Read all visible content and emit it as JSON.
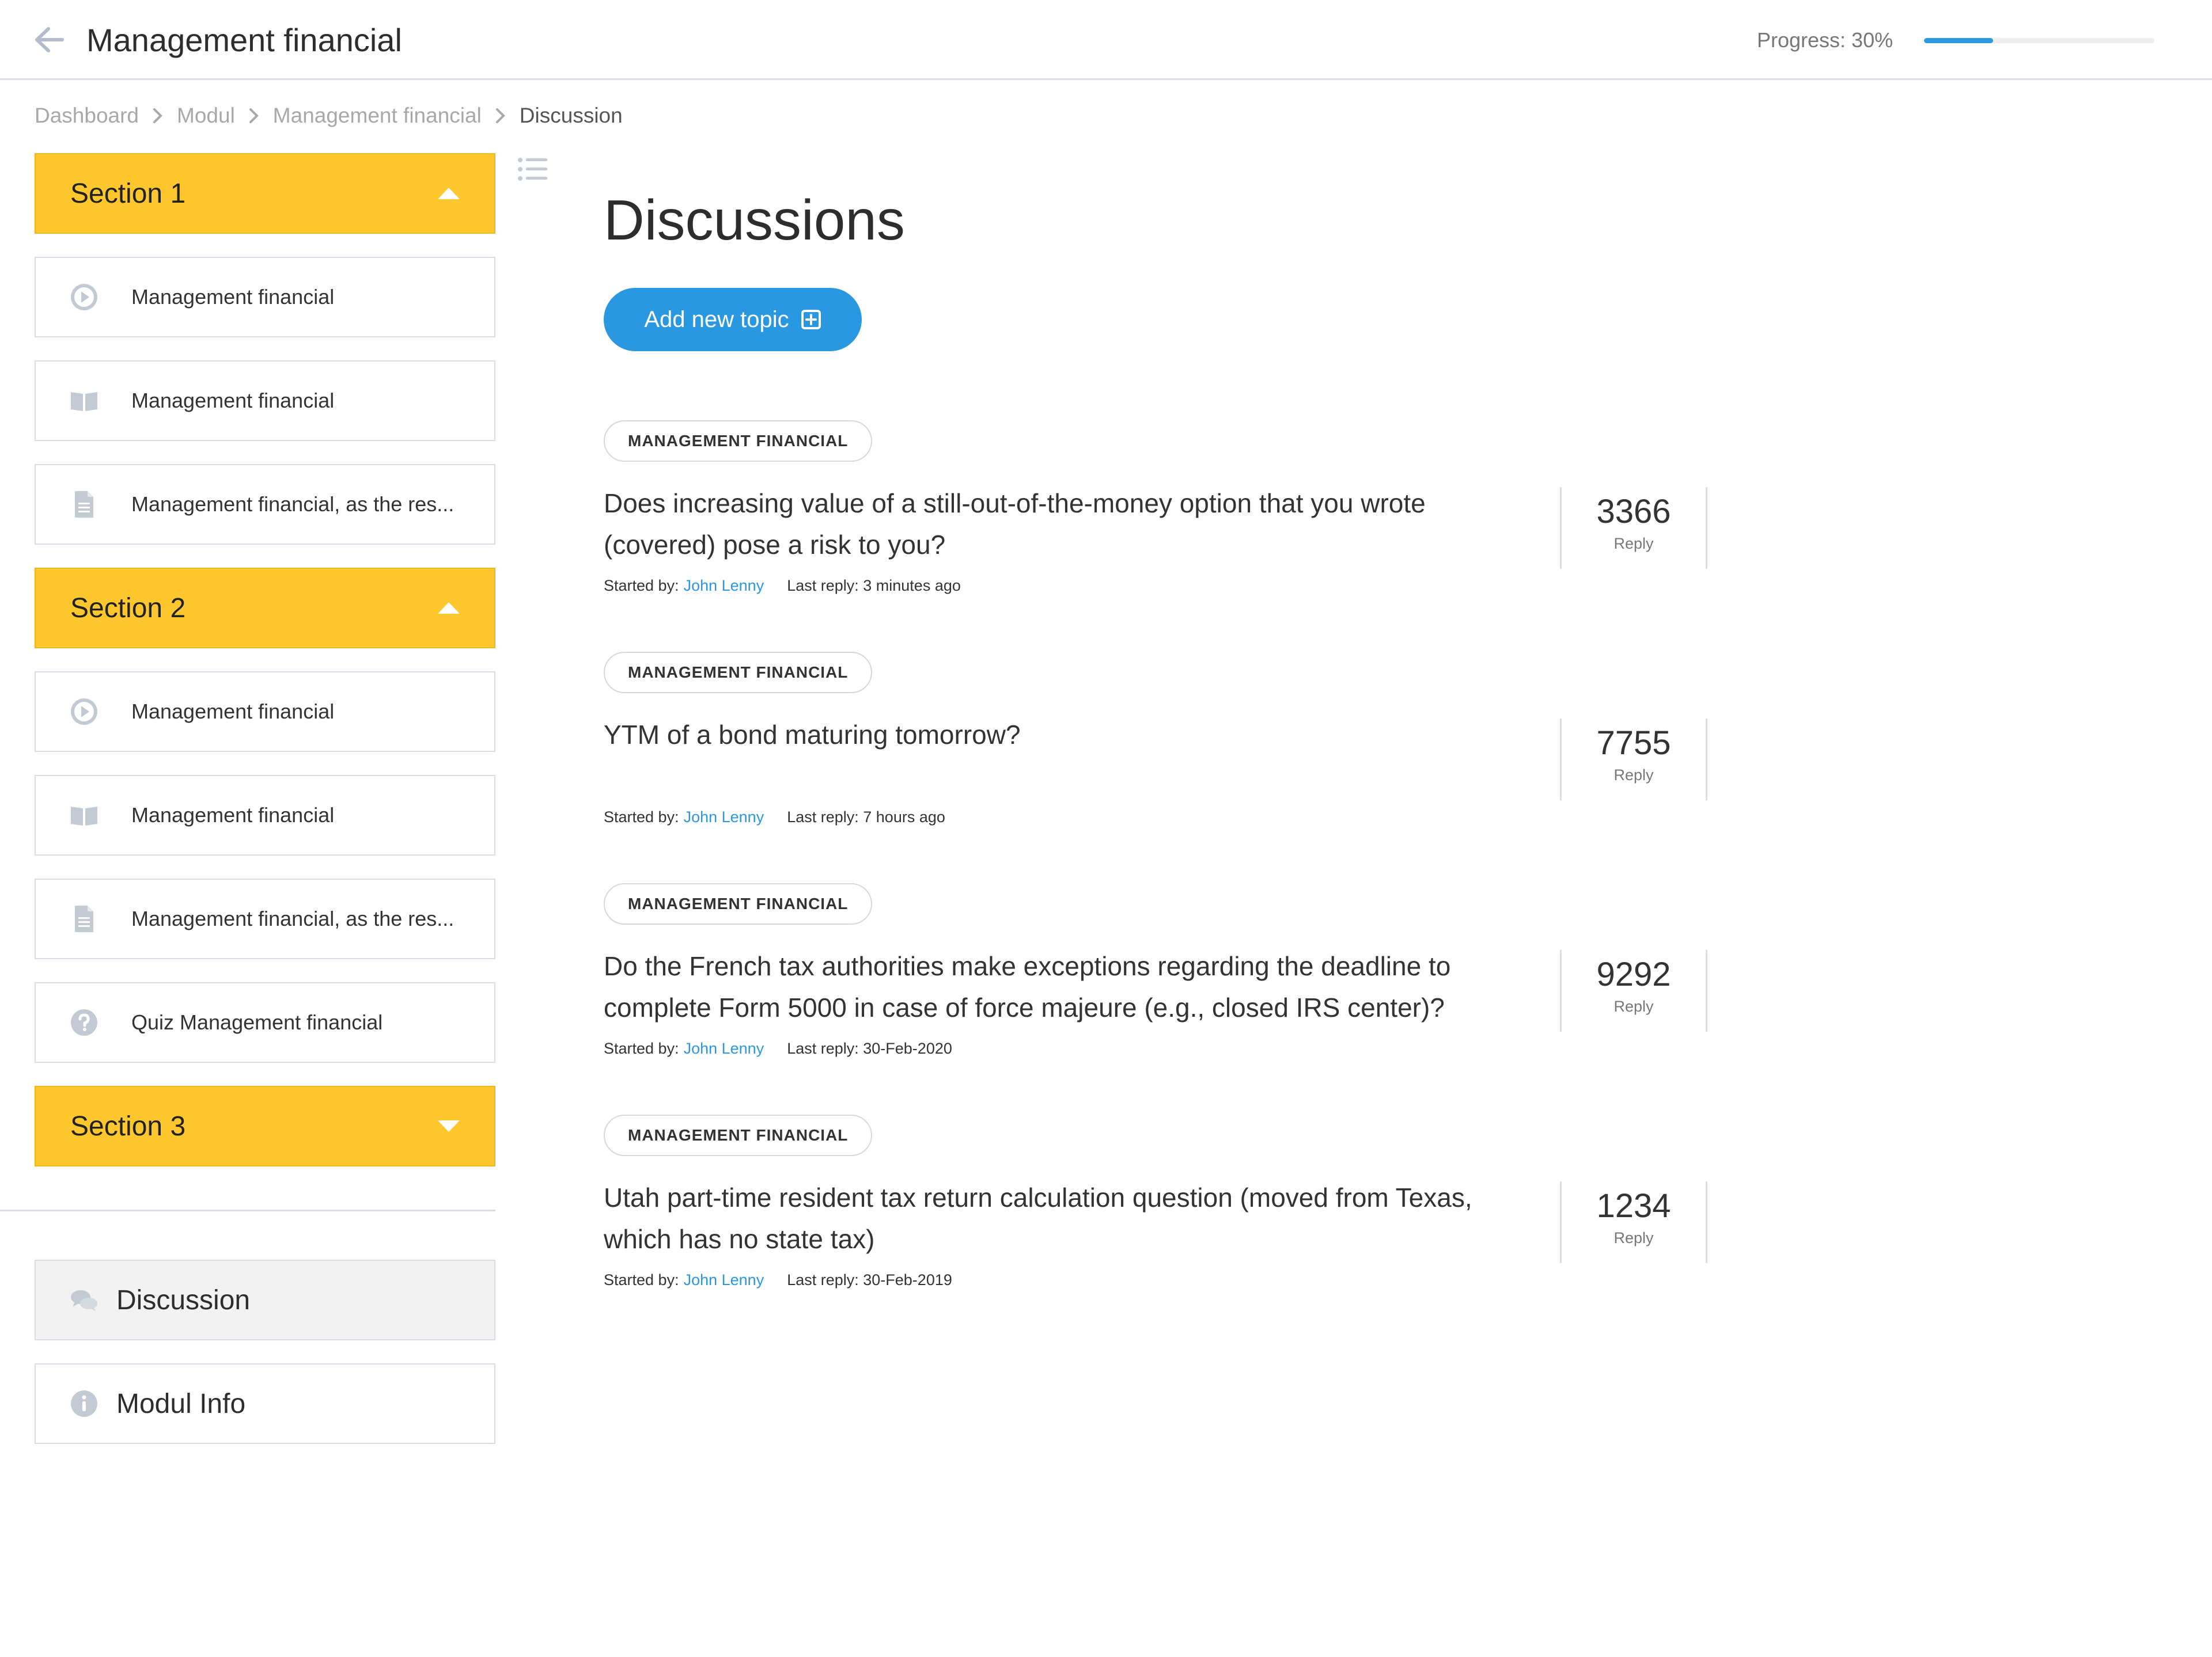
{
  "header": {
    "title": "Management financial",
    "progress_label": "Progress: 30%",
    "progress_value": 0.3
  },
  "breadcrumb": [
    "Dashboard",
    "Modul",
    "Management financial",
    "Discussion"
  ],
  "sidebar": {
    "sections": [
      {
        "title": "Section 1",
        "expanded": true,
        "items": [
          {
            "icon": "play-circle-icon",
            "label": "Management financial"
          },
          {
            "icon": "book-icon",
            "label": "Management financial"
          },
          {
            "icon": "document-icon",
            "label": "Management financial, as the res..."
          }
        ]
      },
      {
        "title": "Section 2",
        "expanded": true,
        "items": [
          {
            "icon": "play-circle-icon",
            "label": "Management financial"
          },
          {
            "icon": "book-icon",
            "label": "Management financial"
          },
          {
            "icon": "document-icon",
            "label": "Management financial, as the res..."
          },
          {
            "icon": "question-circle-icon",
            "label": "Quiz Management financial"
          }
        ]
      },
      {
        "title": "Section 3",
        "expanded": false,
        "items": []
      }
    ],
    "nav": {
      "discussion": {
        "icon": "chat-bubbles-icon",
        "label": "Discussion"
      },
      "modul_info": {
        "icon": "info-circle-icon",
        "label": "Modul Info"
      }
    }
  },
  "main": {
    "title": "Discussions",
    "add_button": "Add new topic",
    "started_by_label": "Started by:",
    "reply_label": "Reply",
    "topics": [
      {
        "tag": "MANAGEMENT FINANCIAL",
        "title": "Does increasing value of a still-out-of-the-money option that you wrote (covered) pose a risk to you?",
        "author": "John Lenny",
        "last_reply": "Last reply: 3 minutes ago",
        "replies": "3366"
      },
      {
        "tag": "MANAGEMENT FINANCIAL",
        "title": "YTM of a bond maturing tomorrow?",
        "author": "John Lenny",
        "last_reply": "Last reply: 7 hours ago",
        "replies": "7755"
      },
      {
        "tag": "MANAGEMENT FINANCIAL",
        "title": "Do the French tax authorities make exceptions regarding the deadline to complete Form 5000 in case of force majeure (e.g., closed IRS center)?",
        "author": "John Lenny",
        "last_reply": "Last reply: 30-Feb-2020",
        "replies": "9292"
      },
      {
        "tag": "MANAGEMENT FINANCIAL",
        "title": "Utah part-time resident tax return calculation question (moved from Texas, which has no state tax)",
        "author": "John Lenny",
        "last_reply": "Last reply: 30-Feb-2019",
        "replies": "1234"
      }
    ]
  },
  "colors": {
    "accent_blue": "#2a98e0",
    "section_yellow": "#fec72e",
    "border_gray": "#d9dde3",
    "icon_gray": "#c3cad4"
  }
}
